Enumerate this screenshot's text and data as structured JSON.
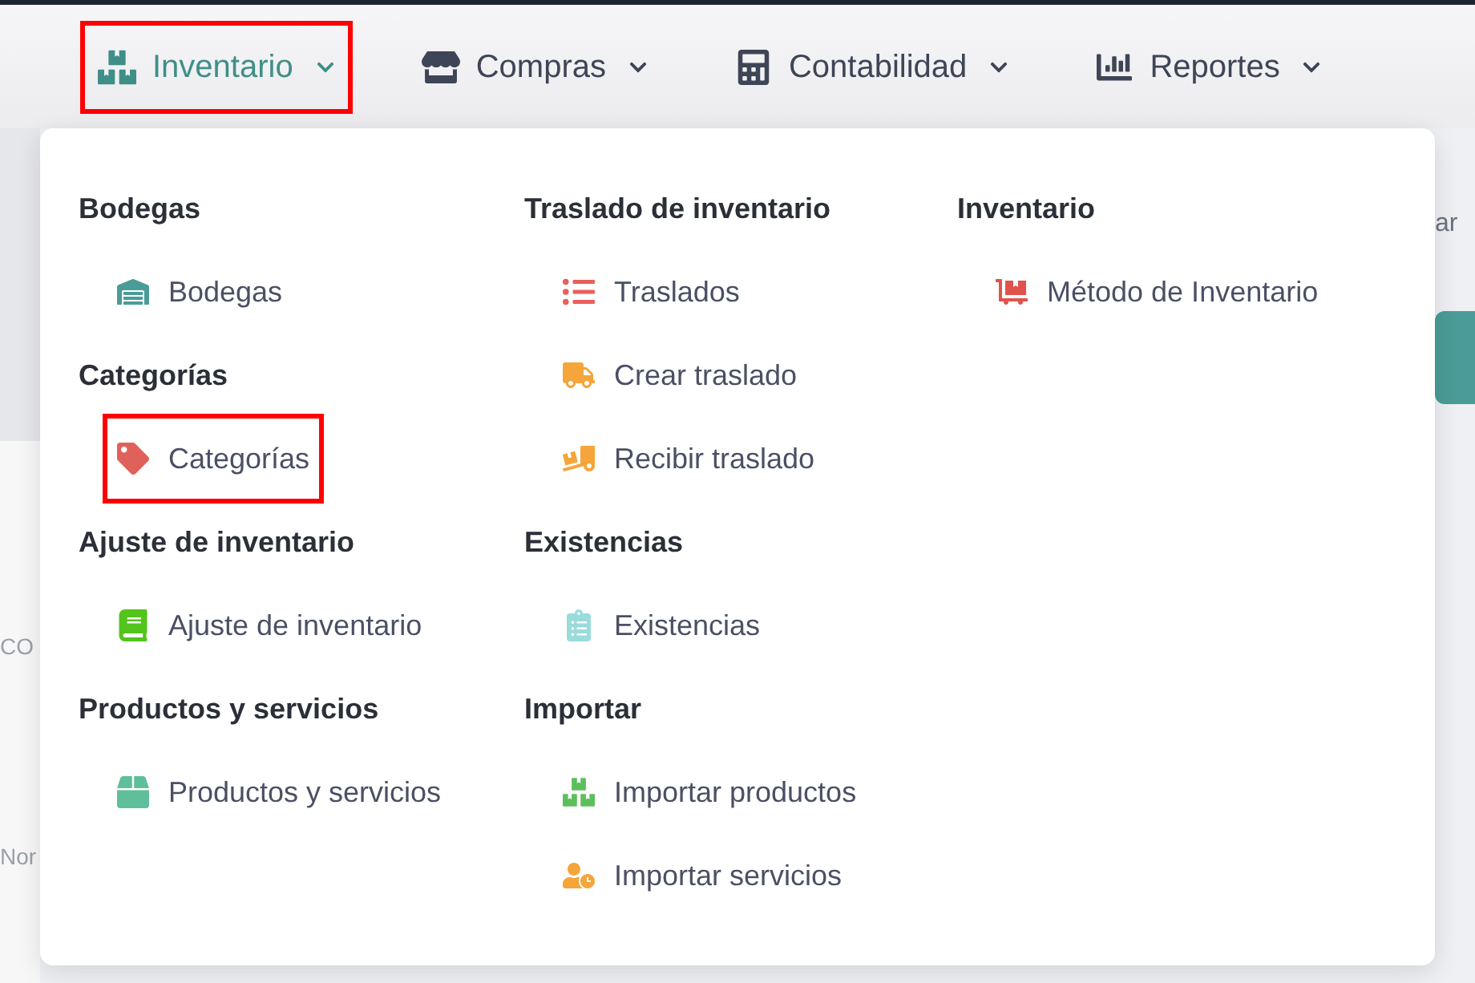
{
  "nav": [
    {
      "label": "Inventario",
      "active": true,
      "highlighted": true
    },
    {
      "label": "Compras",
      "active": false,
      "highlighted": false
    },
    {
      "label": "Contabilidad",
      "active": false,
      "highlighted": false
    },
    {
      "label": "Reportes",
      "active": false,
      "highlighted": false
    }
  ],
  "menu": {
    "columns": [
      {
        "sections": [
          {
            "heading": "Bodegas",
            "items": [
              {
                "label": "Bodegas",
                "highlighted": false
              }
            ]
          },
          {
            "heading": "Categorías",
            "items": [
              {
                "label": "Categorías",
                "highlighted": true
              }
            ]
          },
          {
            "heading": "Ajuste de inventario",
            "items": [
              {
                "label": "Ajuste de inventario",
                "highlighted": false
              }
            ]
          },
          {
            "heading": "Productos y servicios",
            "items": [
              {
                "label": "Productos y servicios",
                "highlighted": false
              }
            ]
          }
        ]
      },
      {
        "sections": [
          {
            "heading": "Traslado de inventario",
            "items": [
              {
                "label": "Traslados",
                "highlighted": false
              },
              {
                "label": "Crear traslado",
                "highlighted": false
              },
              {
                "label": "Recibir traslado",
                "highlighted": false
              }
            ]
          },
          {
            "heading": "Existencias",
            "items": [
              {
                "label": "Existencias",
                "highlighted": false
              }
            ]
          },
          {
            "heading": "Importar",
            "items": [
              {
                "label": "Importar productos",
                "highlighted": false
              },
              {
                "label": "Importar servicios",
                "highlighted": false
              }
            ]
          }
        ]
      },
      {
        "sections": [
          {
            "heading": "Inventario",
            "items": [
              {
                "label": "Método de Inventario",
                "highlighted": false
              }
            ]
          }
        ]
      }
    ]
  },
  "background": {
    "left_texts": [
      "CO",
      "Nor"
    ],
    "right_text": "ar"
  }
}
